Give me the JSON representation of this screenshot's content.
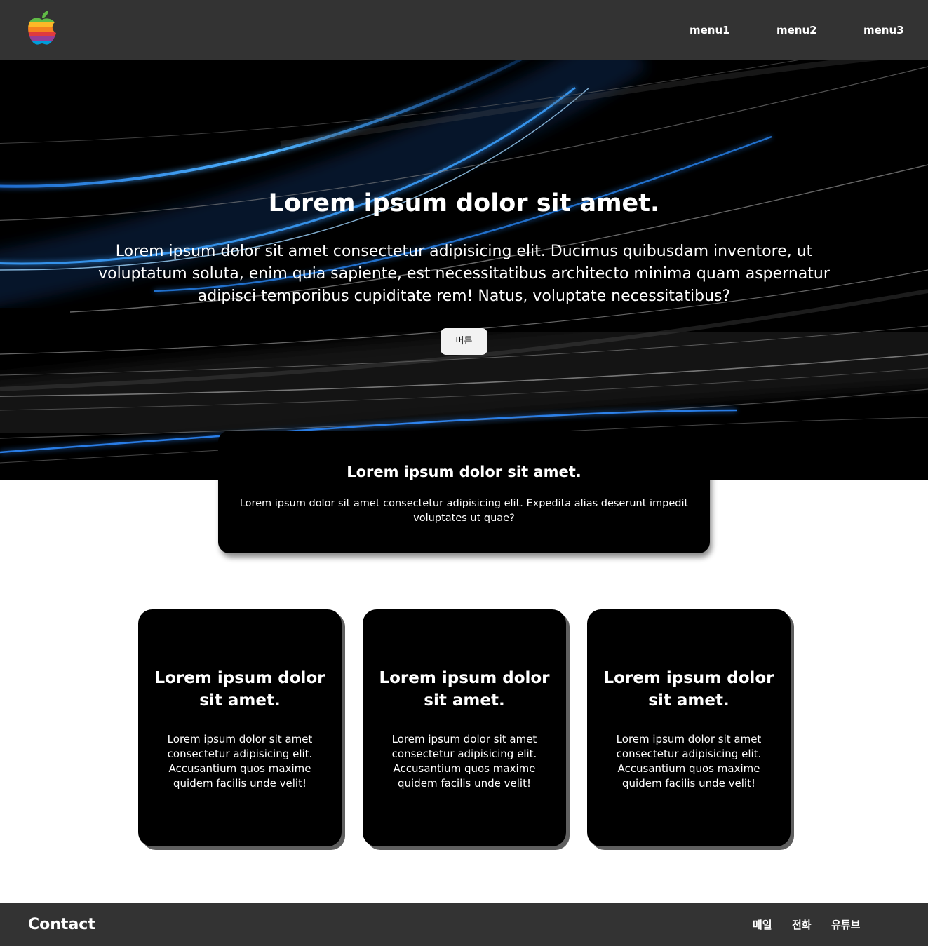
{
  "header": {
    "logo_icon": "rainbow-apple-logo",
    "menu": [
      "menu1",
      "menu2",
      "menu3"
    ],
    "background": "#333333"
  },
  "hero": {
    "title": "Lorem ipsum dolor sit amet.",
    "text": "Lorem ipsum dolor sit amet consectetur adipisicing elit. Ducimus quibusdam inventore, ut voluptatum soluta, enim quia sapiente, est necessitatibus architecto minima quam aspernatur adipisci temporibus cupiditate rem! Natus, voluptate necessitatibus?",
    "button_label": "버튼",
    "accent": "#1e90ff"
  },
  "feature": {
    "title": "Lorem ipsum dolor sit amet.",
    "text": "Lorem ipsum dolor sit amet consectetur adipisicing elit. Expedita alias deserunt impedit voluptates ut quae?"
  },
  "cards": [
    {
      "title": "Lorem ipsum dolor sit amet.",
      "text": "Lorem ipsum dolor sit amet consectetur adipisicing elit. Accusantium quos maxime quidem facilis unde velit!"
    },
    {
      "title": "Lorem ipsum dolor sit amet.",
      "text": "Lorem ipsum dolor sit amet consectetur adipisicing elit. Accusantium quos maxime quidem facilis unde velit!"
    },
    {
      "title": "Lorem ipsum dolor sit amet.",
      "text": "Lorem ipsum dolor sit amet consectetur adipisicing elit. Accusantium quos maxime quidem facilis unde velit!"
    }
  ],
  "footer": {
    "title": "Contact",
    "links": [
      "메일",
      "전화",
      "유튜브"
    ]
  }
}
